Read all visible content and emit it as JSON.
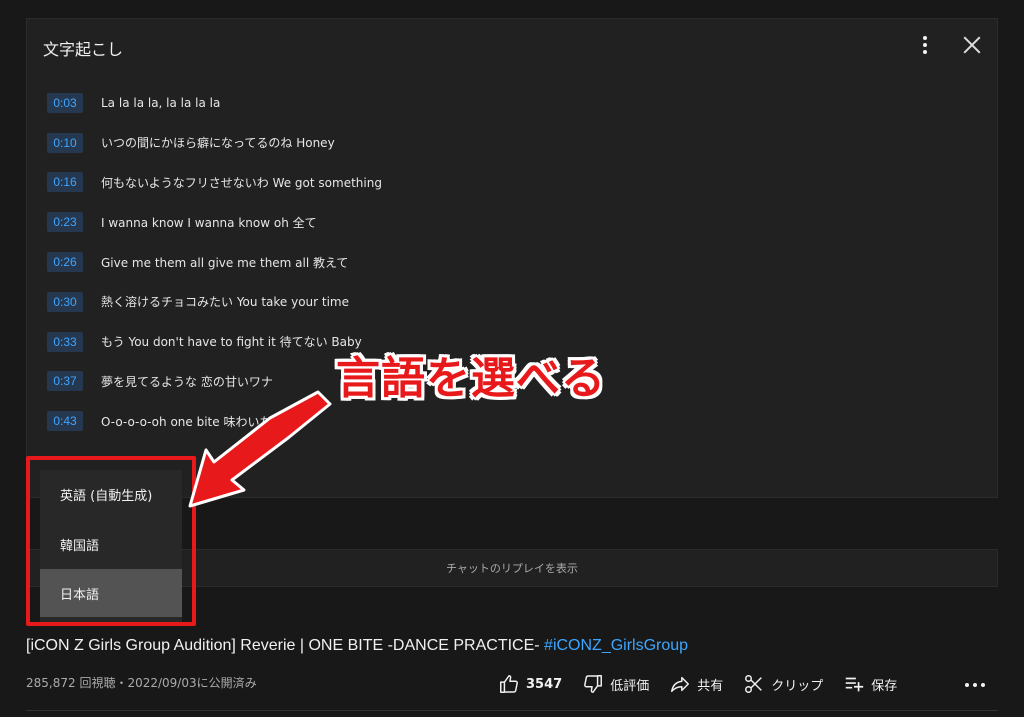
{
  "transcript": {
    "title": "文字起こし",
    "segments": [
      {
        "time": "0:03",
        "text": "La la la la, la la la la"
      },
      {
        "time": "0:10",
        "text": "いつの間にかほら癖になってるのね Honey"
      },
      {
        "time": "0:16",
        "text": "何もないようなフリさせないわ We got something"
      },
      {
        "time": "0:23",
        "text": "I wanna know I wanna know oh 全て"
      },
      {
        "time": "0:26",
        "text": "Give me them all give me them all 教えて"
      },
      {
        "time": "0:30",
        "text": "熱く溶けるチョコみたい You take your time"
      },
      {
        "time": "0:33",
        "text": "もう You don't have to fight it 待てない Baby"
      },
      {
        "time": "0:37",
        "text": "夢を見てるような 恋の甘いワナ"
      },
      {
        "time": "0:43",
        "text": "O-o-o-o-oh one bite 味わいたい"
      }
    ]
  },
  "language_menu": {
    "items": [
      "英語 (自動生成)",
      "韓国語",
      "日本語"
    ],
    "selected": "日本語"
  },
  "chat_replay": {
    "label": "チャットのリプレイを表示"
  },
  "annotation": {
    "text": "言語を選べる",
    "color": "#e8191b"
  },
  "video": {
    "title_prefix": "[iCON Z Girls Group Audition] Reverie | ONE BITE -DANCE PRACTICE- ",
    "hashtag": "#iCONZ_GirlsGroup",
    "meta": "285,872 回視聴・2022/09/03に公開済み",
    "actions": {
      "like_count": "3547",
      "dislike": "低評価",
      "share": "共有",
      "clip": "クリップ",
      "save": "保存"
    }
  },
  "colors": {
    "background": "#181818",
    "panel": "#212121",
    "timestamp_bg": "#263850",
    "timestamp_text": "#3ea6ff",
    "link": "#3ea6ff",
    "highlight": "#e8191b"
  }
}
